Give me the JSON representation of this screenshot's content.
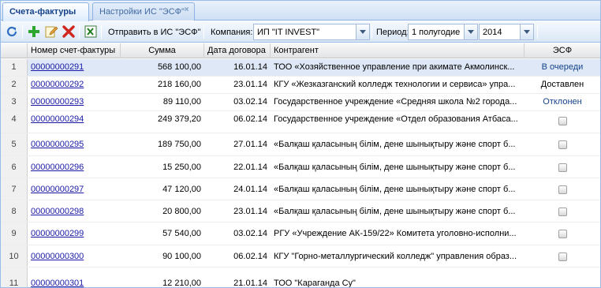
{
  "tabs": [
    {
      "label": "Счета-фактуры"
    },
    {
      "label": "Настройки ИС \"ЭСФ\""
    }
  ],
  "toolbar": {
    "send_label": "Отправить в ИС \"ЭСФ\"",
    "company_label": "Компания:",
    "company_value": "ИП \"IT INVEST\"",
    "period_label": "Период:",
    "period_value": "1 полугодие",
    "year_value": "2014"
  },
  "columns": {
    "invoice": "Номер счет-фактуры",
    "sum": "Сумма",
    "date": "Дата договора",
    "party": "Контрагент",
    "esf": "ЭСФ"
  },
  "rows": [
    {
      "n": "1",
      "invoice": "00000000291",
      "sum": "568 100,00",
      "date": "16.01.14",
      "party": "ТОО «Хозяйственное управление при акимате Акмолинск...",
      "esf": "В очереди"
    },
    {
      "n": "2",
      "invoice": "00000000292",
      "sum": "218 160,00",
      "date": "23.01.14",
      "party": "КГУ «Жезказганский колледж технологии и сервиса» упра...",
      "esf": "Доставлен"
    },
    {
      "n": "3",
      "invoice": "00000000293",
      "sum": "89 110,00",
      "date": "03.02.14",
      "party": "Государственное учреждение «Средняя школа №2 города...",
      "esf": "Отклонен"
    },
    {
      "n": "4",
      "invoice": "00000000294",
      "sum": "249 379,20",
      "date": "06.02.14",
      "party": "Государственное учреждение «Отдел образования Атбаса...",
      "esf": ""
    },
    {
      "n": "5",
      "invoice": "00000000295",
      "sum": "189 750,00",
      "date": "27.01.14",
      "party": "«Балқаш қаласының білім, дене шынықтыру және спорт б...",
      "esf": ""
    },
    {
      "n": "6",
      "invoice": "00000000296",
      "sum": "15 250,00",
      "date": "22.01.14",
      "party": "«Балқаш қаласының білім, дене шынықтыру және спорт б...",
      "esf": ""
    },
    {
      "n": "7",
      "invoice": "00000000297",
      "sum": "47 120,00",
      "date": "24.01.14",
      "party": "«Балқаш қаласының білім, дене шынықтыру және спорт б...",
      "esf": ""
    },
    {
      "n": "8",
      "invoice": "00000000298",
      "sum": "20 800,00",
      "date": "23.01.14",
      "party": "«Балқаш қаласының білім, дене шынықтыру және спорт б...",
      "esf": ""
    },
    {
      "n": "9",
      "invoice": "00000000299",
      "sum": "57 540,00",
      "date": "03.02.14",
      "party": "РГУ «Учреждение АК-159/22» Комитета уголовно-исполни...",
      "esf": ""
    },
    {
      "n": "10",
      "invoice": "00000000300",
      "sum": "90 100,00",
      "date": "06.02.14",
      "party": "КГУ \"Горно-металлургический колледж\" управления образ...",
      "esf": ""
    },
    {
      "n": "11",
      "invoice": "00000000301",
      "sum": "12 210,00",
      "date": "21.01.14",
      "party": "ТОО \"Караганда Су\"",
      "esf": ""
    }
  ]
}
